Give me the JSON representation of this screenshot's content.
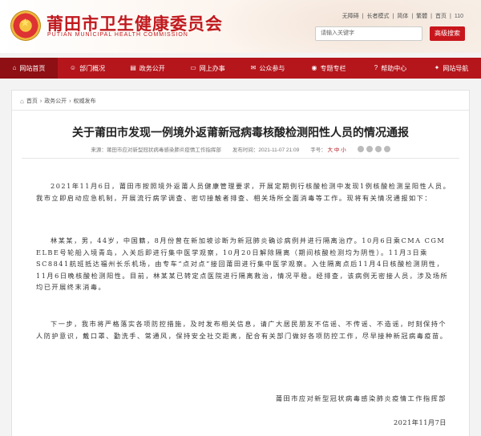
{
  "header": {
    "site_title": "莆田市卫生健康委员会",
    "site_subtitle": "PUTIAN MUNICIPAL HEALTH COMMISSION",
    "top_links": [
      "无障碍",
      "|",
      "长者模式",
      "|",
      "简体",
      "|",
      "繁體",
      "|",
      "首页",
      "|",
      "110"
    ],
    "search_placeholder": "请输入关键字",
    "search_button": "高级搜索"
  },
  "nav": {
    "items": [
      {
        "label": "网站首页",
        "icon": "home-icon"
      },
      {
        "label": "部门概况",
        "icon": "people-icon"
      },
      {
        "label": "政务公开",
        "icon": "document-icon"
      },
      {
        "label": "网上办事",
        "icon": "monitor-icon"
      },
      {
        "label": "公众参与",
        "icon": "chat-icon"
      },
      {
        "label": "专题专栏",
        "icon": "topic-icon"
      },
      {
        "label": "帮助中心",
        "icon": "help-icon"
      },
      {
        "label": "网站导航",
        "icon": "nav-icon"
      }
    ]
  },
  "breadcrumb": {
    "home": "首页",
    "sep": "›",
    "level1": "政务公开",
    "level2": "权威发布"
  },
  "article": {
    "title": "关于莆田市发现一例境外返莆新冠病毒核酸检测阳性人员的情况通报",
    "source_label": "来源：",
    "source": "莆田市应对新型冠状病毒感染肺炎疫情工作指挥部",
    "time_label": "发布时间：",
    "time": "2021-11-07 21:09",
    "font_label": "字号：",
    "font_big": "大",
    "font_mid": "中",
    "font_small": "小",
    "paragraphs": [
      "2021年11月6日，莆田市按照境外返莆人员健康管理要求，开展定期例行核酸检测中发现1例核酸检测呈阳性人员。我市立即启动应急机制，开展流行病学调查、密切接触者排查、相关场所全面消毒等工作。现将有关情况通报如下：",
      "林某某，男，44岁，中国籍，8月份曾在新加坡诊断为新冠肺炎确诊病例并进行隔离治疗。10月6日乘CMA CGM ELBE号轮船入境青岛，入关后即进行集中医学观察，10月20日解除隔离（期间核酸检测均为阴性）。11月3日乘SC8841航班抵达福州长乐机场，由专车“点对点”接回莆田进行集中医学观察。入住隔离点后11月4日核酸检测阴性，11月6日晚核酸检测阳性。目前，林某某已转定点医院进行隔离救治，情况平稳。经排查，该病例无密接人员，涉及场所均已开展终末消毒。",
      "下一步，我市将严格落实各项防控措施，及时发布相关信息，请广大居民朋友不信谣、不传谣、不造谣，时刻保持个人防护意识，戴口罩、勤洗手、常通风，保持安全社交距离，配合有关部门做好各项防控工作，尽早接种新冠病毒疫苗。"
    ],
    "signature": "莆田市应对新型冠状病毒感染肺炎疫情工作指挥部",
    "date": "2021年11月7日"
  },
  "colors": {
    "brand_red": "#b4161c",
    "nav_active": "#8e0f14"
  }
}
